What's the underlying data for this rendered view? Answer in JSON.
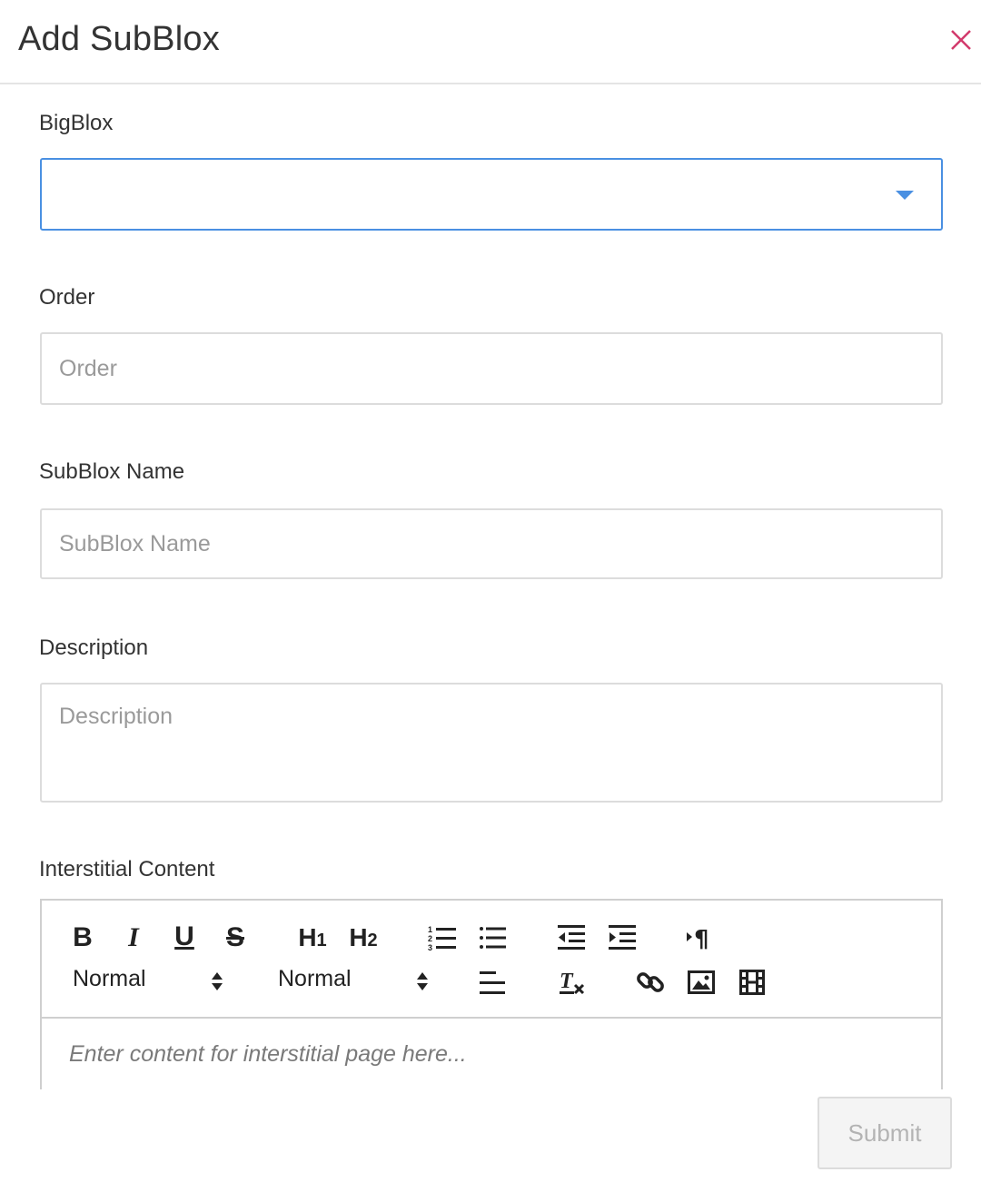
{
  "modal": {
    "title": "Add SubBlox",
    "close_icon": "close-icon",
    "accent_color": "#4a90e2",
    "close_color": "#d2396b"
  },
  "form": {
    "bigblox": {
      "label": "BigBlox",
      "value": ""
    },
    "order": {
      "label": "Order",
      "placeholder": "Order"
    },
    "subblox_name": {
      "label": "SubBlox Name",
      "placeholder": "SubBlox Name"
    },
    "description": {
      "label": "Description",
      "placeholder": "Description"
    },
    "interstitial": {
      "label": "Interstitial Content",
      "placeholder": "Enter content for interstitial page here...",
      "toolbar": {
        "bold": "B",
        "italic": "I",
        "underline": "U",
        "strike": "S",
        "h1": "H",
        "h1_sub": "1",
        "h2": "H",
        "h2_sub": "2",
        "size_select": "Normal",
        "header_select": "Normal",
        "icons": [
          "bold-icon",
          "italic-icon",
          "underline-icon",
          "strikethrough-icon",
          "h1-icon",
          "h2-icon",
          "ordered-list-icon",
          "bullet-list-icon",
          "outdent-icon",
          "indent-icon",
          "text-direction-icon",
          "align-icon",
          "clear-format-icon",
          "link-icon",
          "image-icon",
          "video-icon"
        ]
      }
    }
  },
  "footer": {
    "submit_label": "Submit"
  }
}
